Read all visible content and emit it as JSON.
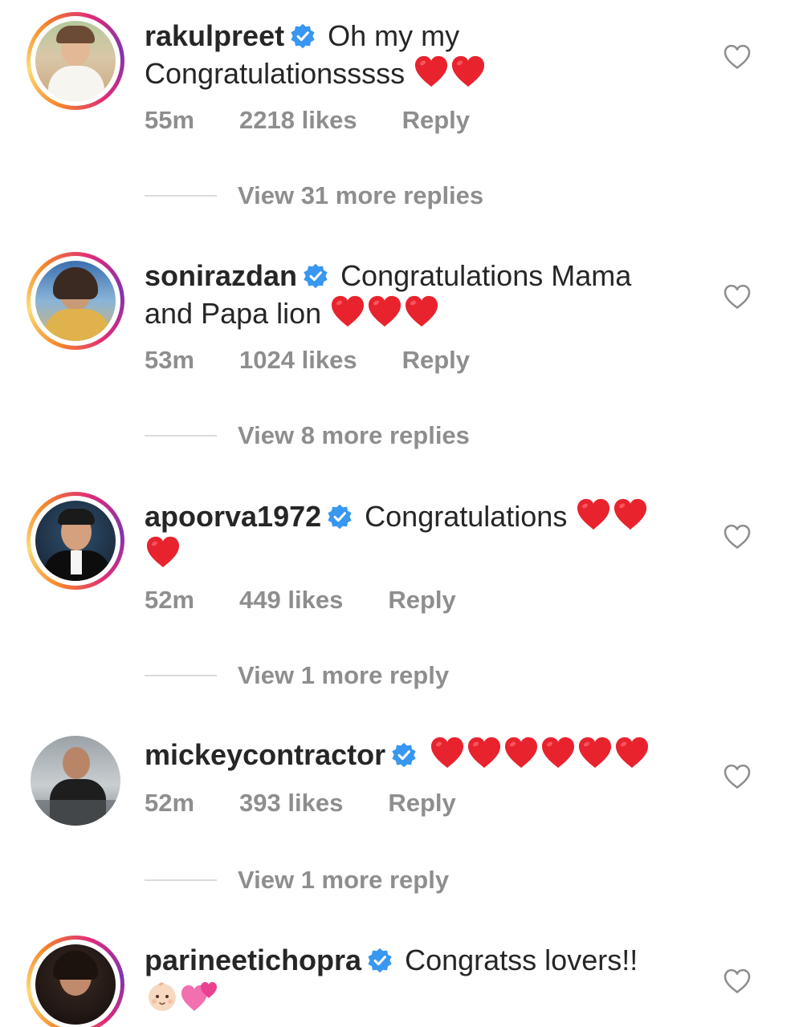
{
  "comments": [
    {
      "username": "rakulpreet",
      "text_line1": "Oh my my",
      "text_line2": "Congratulationsssss",
      "hearts": 2,
      "time": "55m",
      "likes": "2218 likes",
      "reply": "Reply",
      "view_replies": "View 31 more replies"
    },
    {
      "username": "sonirazdan",
      "text_line1": "Congratulations Mama",
      "text_line2": "and Papa lion",
      "hearts": 3,
      "time": "53m",
      "likes": "1024 likes",
      "reply": "Reply",
      "view_replies": "View 8 more replies"
    },
    {
      "username": "apoorva1972",
      "text_line1": "Congratulations",
      "hearts": 3,
      "time": "52m",
      "likes": "449 likes",
      "reply": "Reply",
      "view_replies": "View 1 more reply"
    },
    {
      "username": "mickeycontractor",
      "hearts": 6,
      "time": "52m",
      "likes": "393 likes",
      "reply": "Reply",
      "view_replies": "View 1 more reply"
    },
    {
      "username": "parineetichopra",
      "text_line1": "Congratss lovers!!",
      "emojis": [
        "baby-emoji",
        "two-hearts-emoji"
      ]
    }
  ],
  "colors": {
    "verified_blue": "#3897f0",
    "heart_red": "#e8232e",
    "meta_gray": "#8e8e8e",
    "text": "#262626"
  }
}
